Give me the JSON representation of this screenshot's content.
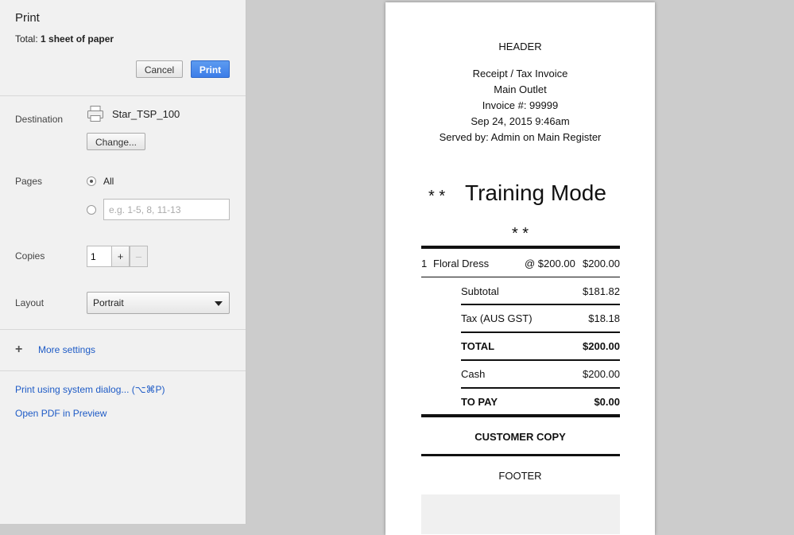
{
  "sidebar": {
    "title": "Print",
    "total_prefix": "Total:",
    "total_value": "1 sheet of paper",
    "cancel_label": "Cancel",
    "print_label": "Print",
    "destination": {
      "label": "Destination",
      "printer_name": "Star_TSP_100",
      "change_label": "Change..."
    },
    "pages": {
      "label": "Pages",
      "all_label": "All",
      "custom_placeholder": "e.g. 1-5, 8, 11-13"
    },
    "copies": {
      "label": "Copies",
      "value": "1",
      "plus": "+",
      "minus": "–"
    },
    "layout": {
      "label": "Layout",
      "selected": "Portrait"
    },
    "more_settings": "More settings",
    "system_dialog_link": "Print using system dialog... (⌥⌘P)",
    "open_pdf_link": "Open PDF in Preview"
  },
  "receipt": {
    "header": "HEADER",
    "heading_lines": [
      "Receipt / Tax Invoice",
      "Main Outlet",
      "Invoice #: 99999",
      "Sep 24, 2015 9:46am",
      "Served by: Admin on Main Register"
    ],
    "training_prefix": "* *",
    "training_title": "Training Mode",
    "training_suffix": "* *",
    "line_item": {
      "qty": "1",
      "name": "Floral Dress",
      "unit": "@ $200.00",
      "total": "$200.00"
    },
    "subtotal_label": "Subtotal",
    "subtotal_value": "$181.82",
    "tax_label": "Tax (AUS GST)",
    "tax_value": "$18.18",
    "total_label": "TOTAL",
    "total_value": "$200.00",
    "cash_label": "Cash",
    "cash_value": "$200.00",
    "topay_label": "TO PAY",
    "topay_value": "$0.00",
    "customer_copy": "CUSTOMER COPY",
    "footer": "FOOTER"
  }
}
